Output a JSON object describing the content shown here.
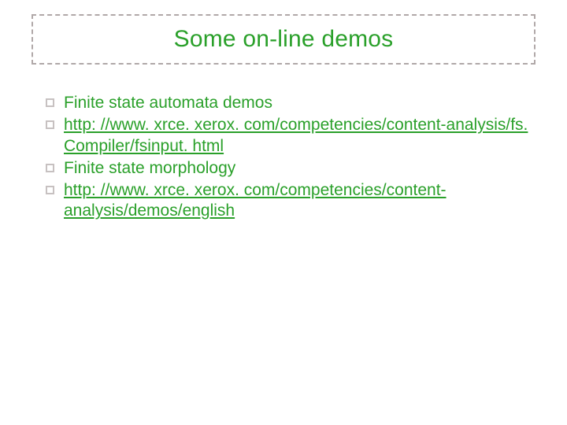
{
  "slide": {
    "title": "Some on-line demos",
    "bullets": [
      {
        "text": "Finite state automata demos",
        "is_link": false
      },
      {
        "text": "http: //www. xrce. xerox. com/competencies/content-analysis/fs. Compiler/fsinput. html",
        "is_link": true
      },
      {
        "text": "Finite state morphology",
        "is_link": false
      },
      {
        "text": "http: //www. xrce. xerox. com/competencies/content-analysis/demos/english",
        "is_link": true
      }
    ]
  }
}
